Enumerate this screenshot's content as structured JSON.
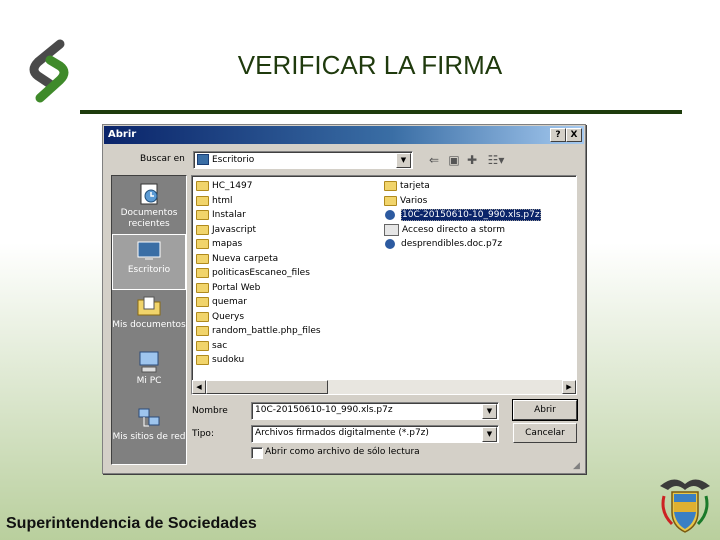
{
  "slide": {
    "title": "VERIFICAR LA FIRMA",
    "footer": "Superintendencia de Sociedades"
  },
  "dialog": {
    "title": "Abrir",
    "help_button": "?",
    "close_button": "X",
    "look_in_label": "Buscar en",
    "look_in_value": "Escritorio",
    "places": [
      {
        "label": "Documentos recientes",
        "icon": "recent-documents-icon"
      },
      {
        "label": "Escritorio",
        "icon": "desktop-icon"
      },
      {
        "label": "Mis documentos",
        "icon": "my-documents-icon"
      },
      {
        "label": "Mi PC",
        "icon": "my-computer-icon"
      },
      {
        "label": "Mis sitios de red",
        "icon": "network-places-icon"
      }
    ],
    "files_col1": [
      {
        "name": "HC_1497",
        "type": "folder"
      },
      {
        "name": "html",
        "type": "folder"
      },
      {
        "name": "Instalar",
        "type": "folder"
      },
      {
        "name": "Javascript",
        "type": "folder"
      },
      {
        "name": "mapas",
        "type": "folder"
      },
      {
        "name": "Nueva carpeta",
        "type": "folder"
      },
      {
        "name": "politicasEscaneo_files",
        "type": "folder"
      },
      {
        "name": "Portal Web",
        "type": "folder"
      },
      {
        "name": "quemar",
        "type": "folder"
      },
      {
        "name": "Querys",
        "type": "folder"
      },
      {
        "name": "random_battle.php_files",
        "type": "folder"
      },
      {
        "name": "sac",
        "type": "folder"
      },
      {
        "name": "sudoku",
        "type": "folder"
      }
    ],
    "files_col2": [
      {
        "name": "tarjeta",
        "type": "folder"
      },
      {
        "name": "Varios",
        "type": "folder"
      },
      {
        "name": "10C-20150610-10_990.xls.p7z",
        "type": "p7z",
        "selected": true
      },
      {
        "name": "Acceso directo a storm",
        "type": "shortcut"
      },
      {
        "name": "desprendibles.doc.p7z",
        "type": "p7z"
      }
    ],
    "file_name_label": "Nombre",
    "file_name_value": "10C-20150610-10_990.xls.p7z",
    "file_type_label": "Tipo:",
    "file_type_value": "Archivos firmados digitalmente (*.p7z)",
    "open_button": "Abrir",
    "cancel_button": "Cancelar",
    "readonly_label": "Abrir como archivo de sólo lectura"
  },
  "colors": {
    "title_text": "#1f3a0d",
    "rule": "#1e3c0d",
    "titlebar_start": "#0a246a",
    "titlebar_end": "#a6caf0"
  }
}
